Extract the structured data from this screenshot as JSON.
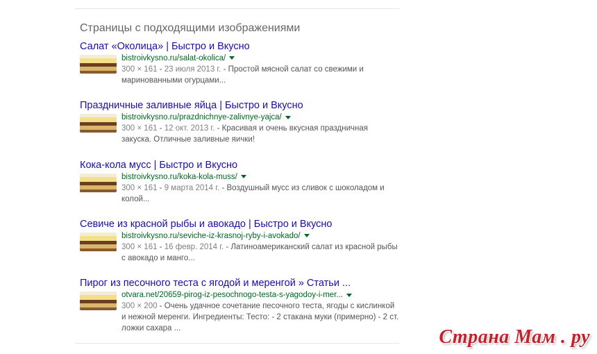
{
  "section_heading": "Страницы с подходящими изображениями",
  "results": [
    {
      "title": "Салат «Околица» | Быстро и Вкусно",
      "url": "bistroivkysno.ru/salat-okolica/",
      "dims": "300 × 161",
      "date": "23 июля 2013 г.",
      "snippet": "Простой мясной салат со свежими и маринованными огурцами..."
    },
    {
      "title": "Праздничные заливные яйца | Быстро и Вкусно",
      "url": "bistroivkysno.ru/prazdnichnye-zalivnye-yajca/",
      "dims": "300 × 161",
      "date": "12 окт. 2013 г.",
      "snippet": "Красивая и очень вкусная праздничная закуска. Отличные заливные яички!"
    },
    {
      "title": "Кока-кола мусс | Быстро и Вкусно",
      "url": "bistroivkysno.ru/koka-kola-muss/",
      "dims": "300 × 161",
      "date": "9 марта 2014 г.",
      "snippet": "Воздушный мусс из сливок с шоколадом и колой..."
    },
    {
      "title": "Севиче из красной рыбы и авокадо | Быстро и Вкусно",
      "url": "bistroivkysno.ru/seviche-iz-krasnoj-ryby-i-avokado/",
      "dims": "300 × 161",
      "date": "16 февр. 2014 г.",
      "snippet": "Латиноамериканский салат из красной рыбы с авокадо и манго..."
    },
    {
      "title": "Пирог из песочного теста с ягодой и меренгой » Статьи ...",
      "url": "otvara.net/20659-pirog-iz-pesochnogo-testa-s-yagodoy-i-mer...",
      "dims": "300 × 200",
      "date": "",
      "snippet": "Очень удачное сочетание песочного теста, ягоды с кислинкой и нежной меренги. Ингредиенты: Тесто: - 2 стакана муки (примерно) - 2 ст. ложки сахара ..."
    }
  ],
  "watermark": "Страна Мам . ру",
  "colors": {
    "title_link": "#1a0dab",
    "url": "#006621",
    "snippet": "#545454",
    "meta": "#808080",
    "watermark": "#c2232b"
  },
  "icons": {
    "thumbnail": "cake-thumbnail-icon",
    "caret": "caret-down-icon"
  }
}
